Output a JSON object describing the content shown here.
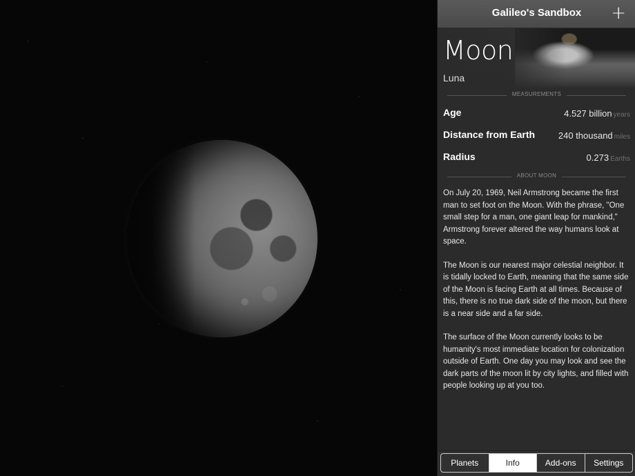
{
  "header": {
    "title": "Galileo's Sandbox",
    "add_symbol": "+"
  },
  "object": {
    "name": "Moon",
    "latin_name": "Luna"
  },
  "measurements": {
    "section_label": "MEASUREMENTS",
    "rows": [
      {
        "label": "Age",
        "value": "4.527 billion",
        "unit": "years"
      },
      {
        "label": "Distance from Earth",
        "value": "240 thousand",
        "unit": "miles"
      },
      {
        "label": "Radius",
        "value": "0.273",
        "unit": "Earths"
      }
    ]
  },
  "about": {
    "section_label": "ABOUT MOON",
    "paragraphs": [
      "On July 20, 1969, Neil Armstrong became the first man to set foot on the Moon. With the phrase, \"One small step for a man, one giant leap for mankind,\" Armstrong forever altered the way humans look at space.",
      "The Moon is our nearest major celestial neighbor. It is tidally locked to Earth, meaning that the same side of the Moon is facing Earth at all times. Because of this, there is no true dark side of the moon, but there is a near side and a far side.",
      "The surface of the Moon currently looks to be humanity's most immediate location for colonization outside of Earth. One day you may look and see the dark parts of the moon lit by city lights, and filled with people looking up at you too."
    ]
  },
  "tabs": [
    {
      "label": "Planets",
      "active": false
    },
    {
      "label": "Info",
      "active": true
    },
    {
      "label": "Add-ons",
      "active": false
    },
    {
      "label": "Settings",
      "active": false
    }
  ]
}
